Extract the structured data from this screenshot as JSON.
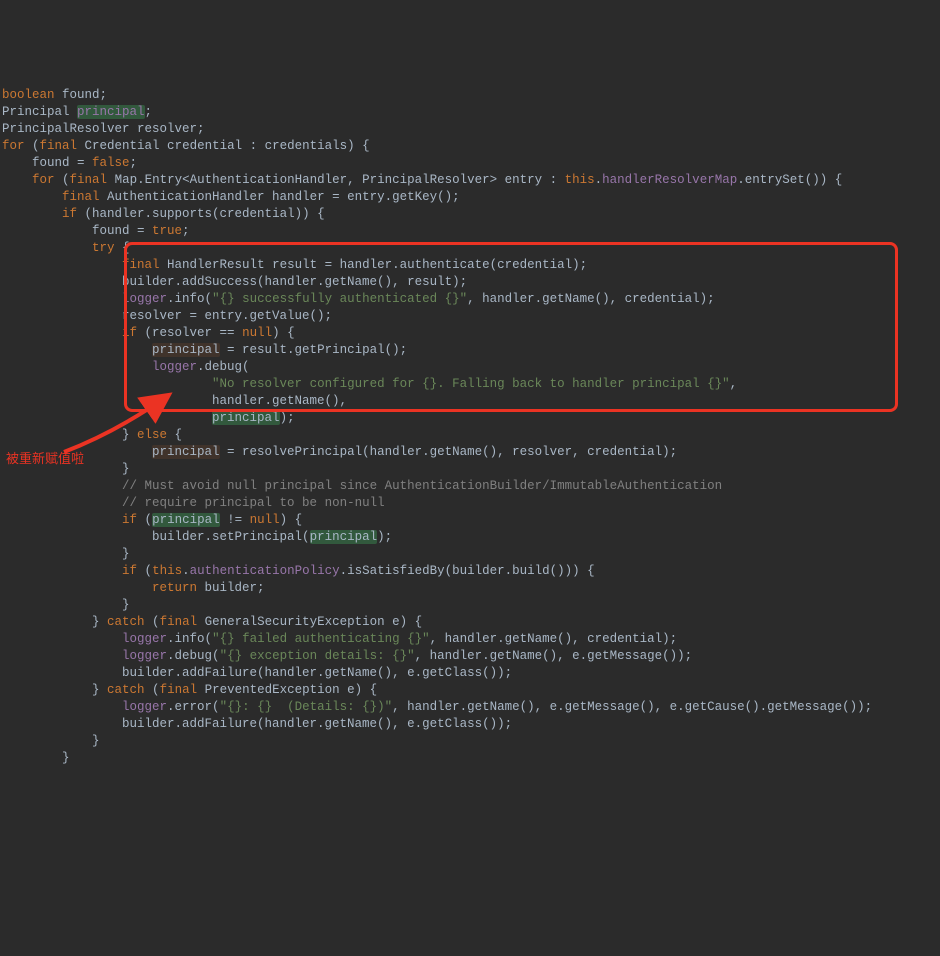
{
  "code": {
    "l1_kw": "boolean",
    "l1_rest": " found;",
    "l2_a": "Principal ",
    "l2_b": "principal",
    "l2_c": ";",
    "l3": "PrincipalResolver resolver;",
    "l4_a": "for",
    "l4_b": " (",
    "l4_c": "final",
    "l4_d": " Credential credential : credentials) {",
    "l5_a": "    found = ",
    "l5_b": "false",
    "l5_c": ";",
    "l6_a": "    ",
    "l6_b": "for",
    "l6_c": " (",
    "l6_d": "final",
    "l6_e": " Map.Entry<AuthenticationHandler, PrincipalResolver> entry : ",
    "l6_f": "this",
    "l6_g": ".",
    "l6_h": "handlerResolverMap",
    "l6_i": ".entrySet()) {",
    "l7_a": "        ",
    "l7_b": "final",
    "l7_c": " AuthenticationHandler handler = entry.getKey();",
    "l8_a": "        ",
    "l8_b": "if",
    "l8_c": " (handler.supports(credential)) {",
    "l9_a": "            found = ",
    "l9_b": "true",
    "l9_c": ";",
    "l10_a": "            ",
    "l10_b": "try",
    "l10_c": " {",
    "l11_a": "                ",
    "l11_b": "final",
    "l11_c": " HandlerResult result = handler.authenticate(credential);",
    "l12": "                builder.addSuccess(handler.getName(), result);",
    "l13_a": "                ",
    "l13_b": "logger",
    "l13_c": ".info(",
    "l13_d": "\"{} successfully authenticated {}\"",
    "l13_e": ", handler.getName(), credential);",
    "l14": "                resolver = entry.getValue();",
    "l15_a": "                ",
    "l15_b": "if",
    "l15_c": " (resolver == ",
    "l15_d": "null",
    "l15_e": ") {",
    "l16_a": "                    ",
    "l16_b": "principal",
    "l16_c": " = result.getPrincipal();",
    "l17_a": "                    ",
    "l17_b": "logger",
    "l17_c": ".debug(",
    "l18_a": "                            ",
    "l18_b": "\"No resolver configured for {}. Falling back to handler principal {}\"",
    "l18_c": ",",
    "l19": "                            handler.getName(),",
    "l20_a": "                            ",
    "l20_b": "principal",
    "l20_c": ");",
    "l21_a": "                } ",
    "l21_b": "else",
    "l21_c": " {",
    "l22_a": "                    ",
    "l22_b": "principal",
    "l22_c": " = resolvePrincipal(handler.getName(), resolver, credential);",
    "l23": "                }",
    "l24_a": "                ",
    "l24_b": "// Must avoid null principal since AuthenticationBuilder/ImmutableAuthentication",
    "l25_a": "                ",
    "l25_b": "// require principal to be non-null",
    "l26_a": "                ",
    "l26_b": "if",
    "l26_c": " (",
    "l26_d": "principal",
    "l26_e": " != ",
    "l26_f": "null",
    "l26_g": ") {",
    "l27_a": "                    builder.setPrincipal(",
    "l27_b": "principal",
    "l27_c": ");",
    "l28": "                }",
    "l29_a": "                ",
    "l29_b": "if",
    "l29_c": " (",
    "l29_d": "this",
    "l29_e": ".",
    "l29_f": "authenticationPolicy",
    "l29_g": ".isSatisfiedBy(builder.build())) {",
    "l30_a": "                    ",
    "l30_b": "return",
    "l30_c": " builder;",
    "l31": "                }",
    "l32_a": "            } ",
    "l32_b": "catch",
    "l32_c": " (",
    "l32_d": "final",
    "l32_e": " GeneralSecurityException e) {",
    "l33_a": "                ",
    "l33_b": "logger",
    "l33_c": ".info(",
    "l33_d": "\"{} failed authenticating {}\"",
    "l33_e": ", handler.getName(), credential);",
    "l34_a": "                ",
    "l34_b": "logger",
    "l34_c": ".debug(",
    "l34_d": "\"{} exception details: {}\"",
    "l34_e": ", handler.getName(), e.getMessage());",
    "l35": "                builder.addFailure(handler.getName(), e.getClass());",
    "l36_a": "            } ",
    "l36_b": "catch",
    "l36_c": " (",
    "l36_d": "final",
    "l36_e": " PreventedException e) {",
    "l37_a": "                ",
    "l37_b": "logger",
    "l37_c": ".error(",
    "l37_d": "\"{}: {}  (Details: {})\"",
    "l37_e": ", handler.getName(), e.getMessage(), e.getCause().getMessage());",
    "l38": "                builder.addFailure(handler.getName(), e.getClass());",
    "l39": "            }",
    "l40": "        }"
  },
  "annotations": {
    "label_text": "被重新赋值啦",
    "highlight_color": "#eb3323"
  }
}
